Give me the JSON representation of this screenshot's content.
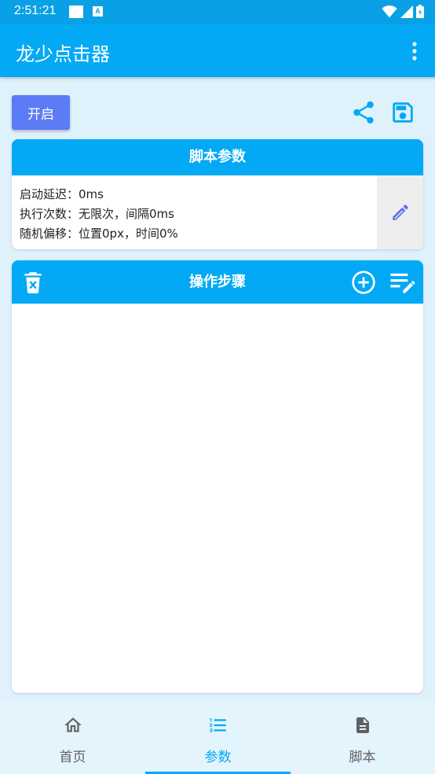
{
  "status_bar": {
    "time": "2:51:21",
    "notification_icon_text": "A"
  },
  "app_bar": {
    "title": "龙少点击器",
    "overflow_icon": "more-vert-icon"
  },
  "toolbar": {
    "start_label": "开启",
    "share_icon": "share-icon",
    "save_icon": "save-icon"
  },
  "params_card": {
    "title": "脚本参数",
    "lines": [
      "启动延迟：0ms",
      "执行次数：无限次，间隔0ms",
      "随机偏移：位置0px，时间0%"
    ],
    "edit_icon": "pencil-icon"
  },
  "steps_card": {
    "title": "操作步骤",
    "icons": [
      "delete-icon",
      "add-circle-icon",
      "edit-list-icon"
    ]
  },
  "bottom_nav": {
    "items": [
      {
        "label": "首页",
        "icon": "home-icon"
      },
      {
        "label": "参数",
        "icon": "numbered-list-icon"
      },
      {
        "label": "脚本",
        "icon": "document-icon"
      }
    ],
    "active_index": 1
  },
  "colors": {
    "primary": "#03a9f4",
    "status_bar": "#0aa0e6",
    "start_button": "#5b7cf5",
    "background": "#dff2fc",
    "edit_icon": "#5b6ee1"
  }
}
